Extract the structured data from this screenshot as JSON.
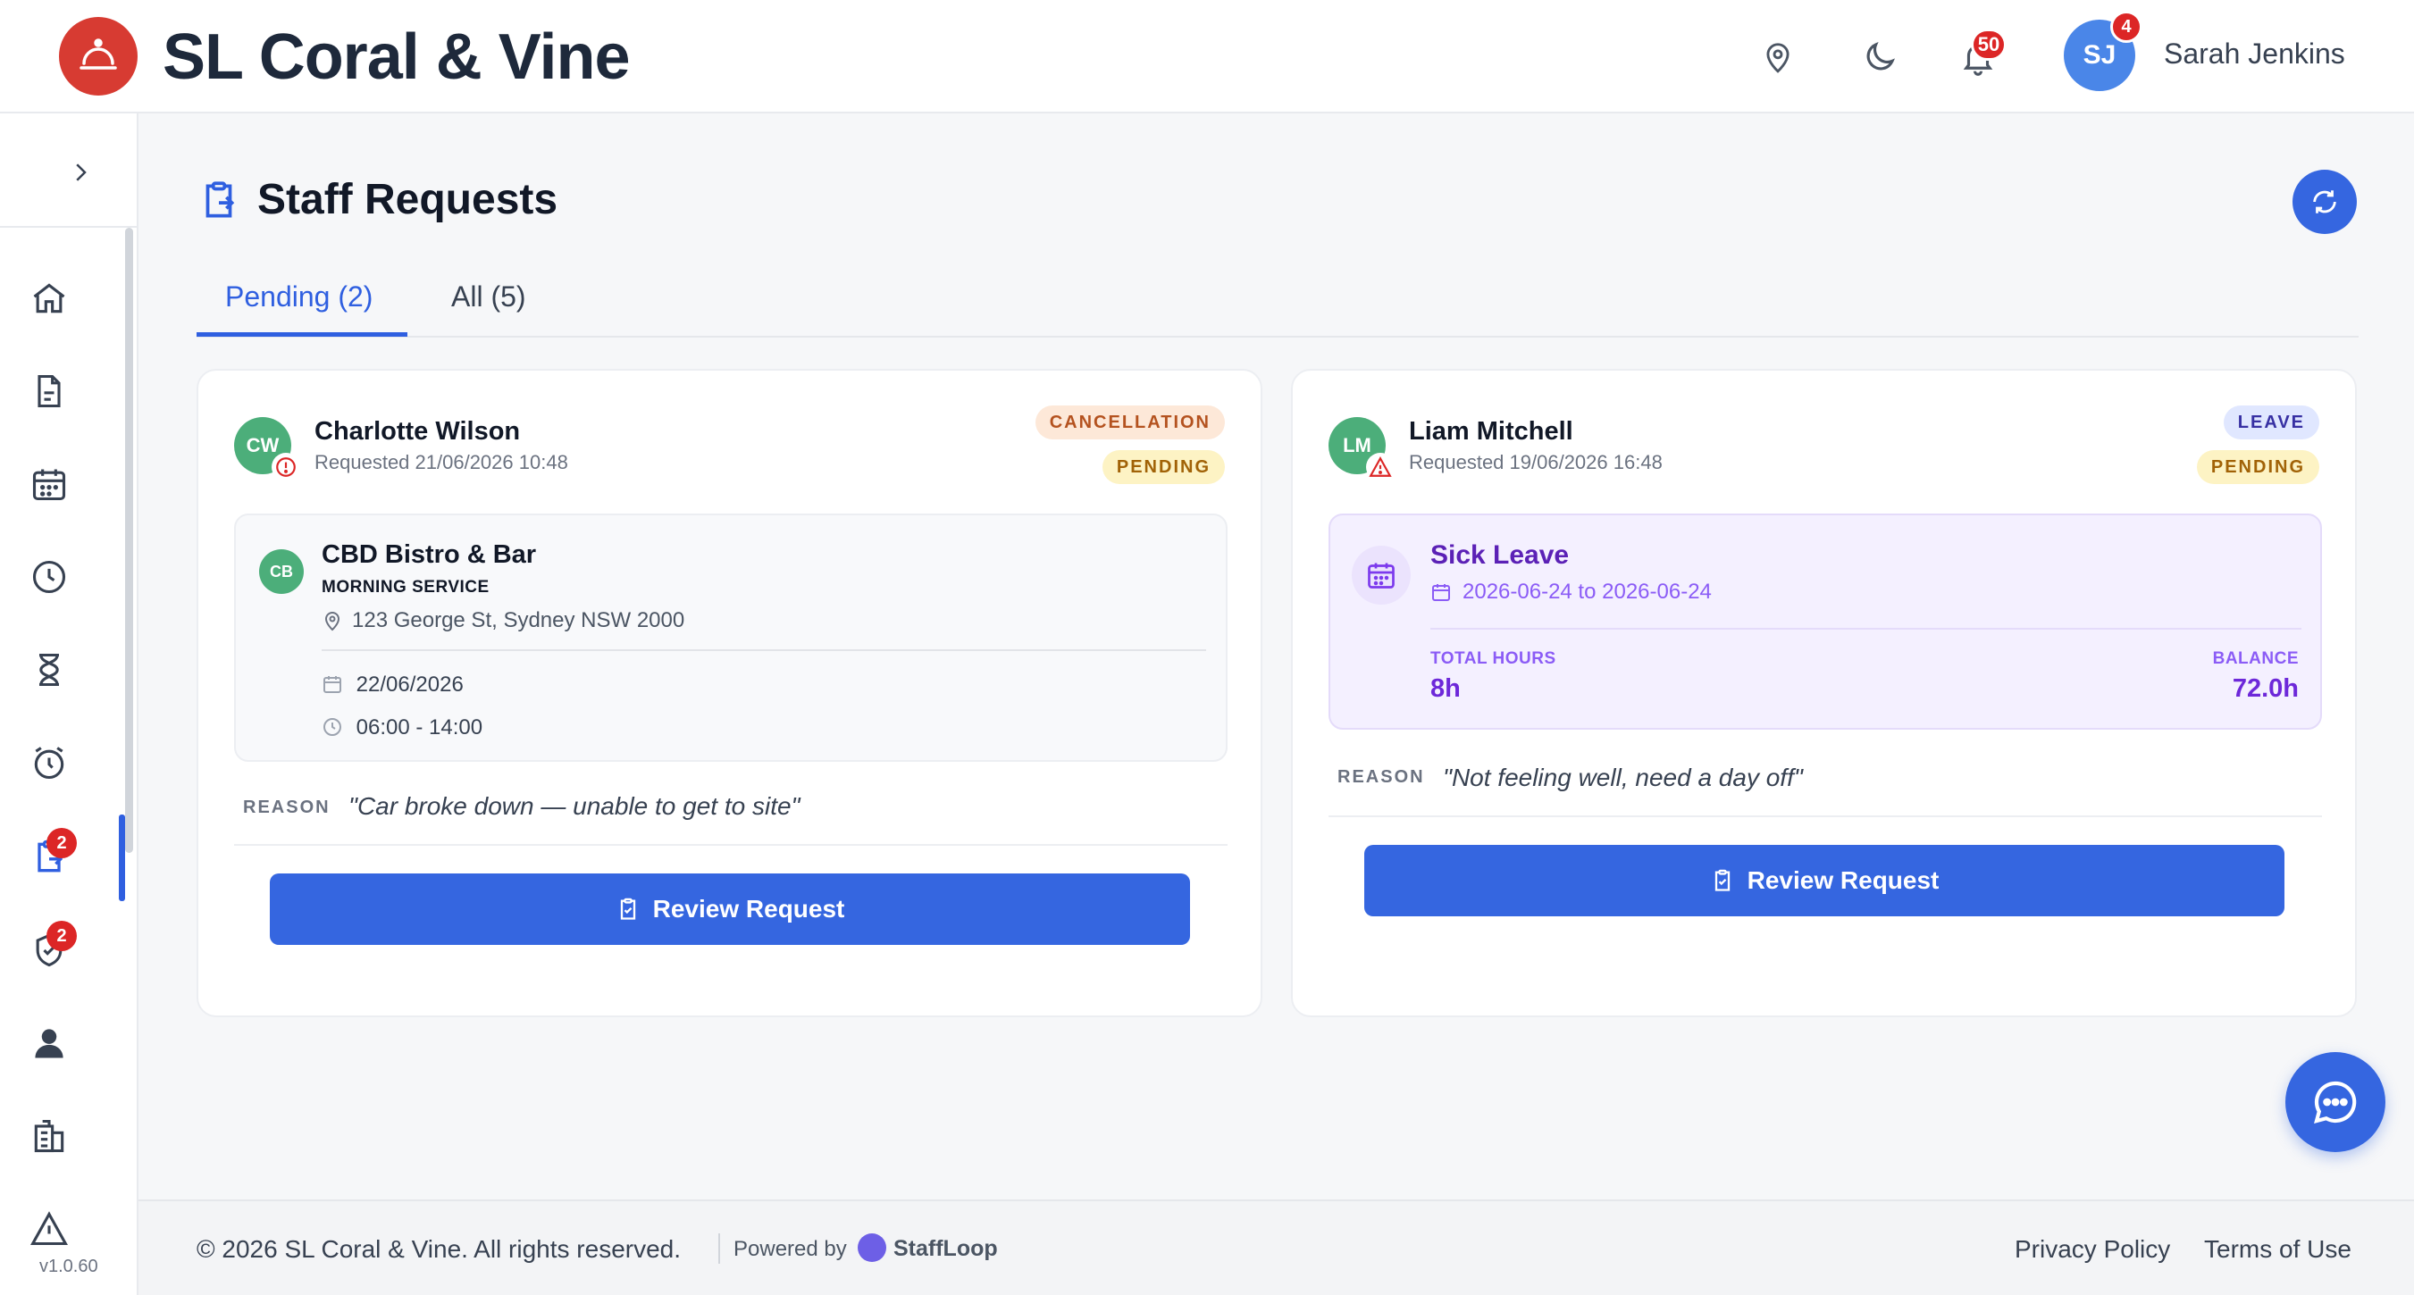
{
  "app": {
    "brand": "SL Coral & Vine",
    "notifications_count": "50",
    "user_badge_count": "4",
    "user_initials": "SJ",
    "user_name": "Sarah Jenkins"
  },
  "sidebar": {
    "items": [
      {
        "icon": "home-icon"
      },
      {
        "icon": "document-icon"
      },
      {
        "icon": "calendar-icon"
      },
      {
        "icon": "clock-icon"
      },
      {
        "icon": "hourglass-icon"
      },
      {
        "icon": "alarm-icon"
      },
      {
        "icon": "requests-icon",
        "badge": "2"
      },
      {
        "icon": "shield-check-icon",
        "badge": "2"
      },
      {
        "icon": "user-icon"
      },
      {
        "icon": "building-icon"
      },
      {
        "icon": "warning-icon"
      }
    ],
    "version": "v1.0.60"
  },
  "page": {
    "title": "Staff Requests",
    "tabs": [
      {
        "label": "Pending (2)",
        "active": true
      },
      {
        "label": "All (5)",
        "active": false
      }
    ]
  },
  "requests": [
    {
      "initials": "CW",
      "name": "Charlotte Wilson",
      "requested": "Requested 21/06/2026 10:48",
      "type_badge": "CANCELLATION",
      "status_badge": "PENDING",
      "venue_initials": "CB",
      "venue": "CBD Bistro & Bar",
      "service": "MORNING SERVICE",
      "address": "123 George St, Sydney NSW 2000",
      "date": "22/06/2026",
      "time": "06:00 - 14:00",
      "reason_label": "REASON",
      "reason": "\"Car broke down — unable to get to site\"",
      "action": "Review Request"
    },
    {
      "initials": "LM",
      "name": "Liam Mitchell",
      "requested": "Requested 19/06/2026 16:48",
      "type_badge": "LEAVE",
      "status_badge": "PENDING",
      "leave_type": "Sick Leave",
      "leave_dates": "2026-06-24 to 2026-06-24",
      "total_hours_label": "TOTAL HOURS",
      "total_hours": "8h",
      "balance_label": "BALANCE",
      "balance": "72.0h",
      "reason_label": "REASON",
      "reason": "\"Not feeling well, need a day off\"",
      "action": "Review Request"
    }
  ],
  "footer": {
    "copyright": "© 2026 SL Coral & Vine. All rights reserved.",
    "powered_by": "Powered by",
    "powered_brand": "StaffLoop",
    "privacy": "Privacy Policy",
    "terms": "Terms of Use"
  },
  "colors": {
    "primary": "#3566e0",
    "brand_red": "#d73b32",
    "badge_red": "#dc2626",
    "leave_purple": "#6d28d9"
  }
}
